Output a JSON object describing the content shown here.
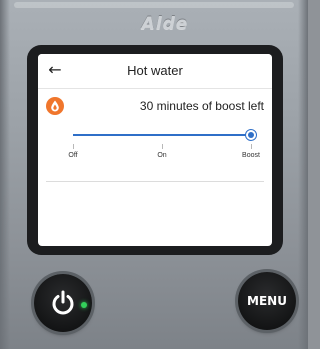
{
  "device": {
    "brand": "Alde",
    "menu_button_label": "MENU"
  },
  "header": {
    "title": "Hot water",
    "back_icon": "arrow-left-icon",
    "back_glyph": "←"
  },
  "status": {
    "icon": "water-drop-icon",
    "icon_color": "#f0762c",
    "text": "30 minutes of boost left"
  },
  "mode_slider": {
    "options": [
      "Off",
      "On",
      "Boost"
    ],
    "selected": "Boost",
    "selected_index": 2,
    "accent_color": "#2f6fc8"
  },
  "power": {
    "icon": "power-icon",
    "indicator_color": "#33d15a",
    "on": true
  }
}
